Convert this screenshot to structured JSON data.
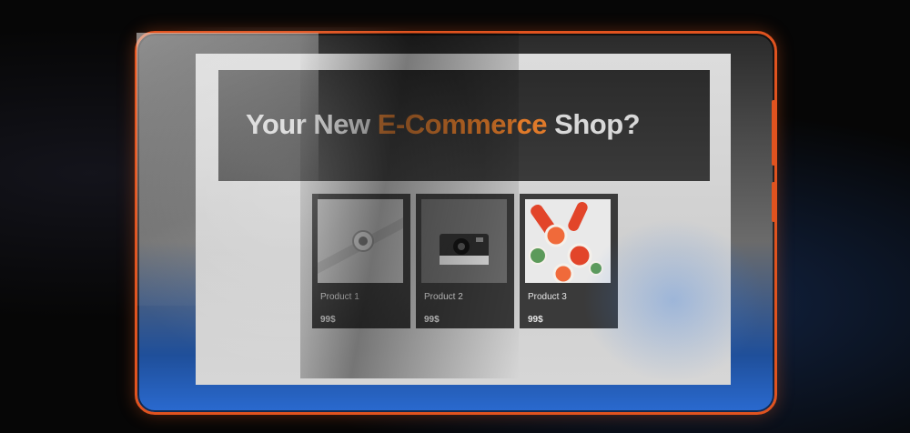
{
  "hero": {
    "title_part1": "Your New ",
    "title_accent": "E-Commerce",
    "title_part2": " Shop?"
  },
  "products": [
    {
      "name": "Product 1",
      "price": "99$",
      "image_icon": "smartwatch-icon"
    },
    {
      "name": "Product 2",
      "price": "99$",
      "image_icon": "instant-camera-icon"
    },
    {
      "name": "Product 3",
      "price": "99$",
      "image_icon": "citrus-slices-icon"
    }
  ],
  "colors": {
    "accent": "#e07a2a",
    "frame": "#e0531f",
    "hero_bg": "#2b2b2b",
    "card_bg": "#3a3a3a"
  }
}
